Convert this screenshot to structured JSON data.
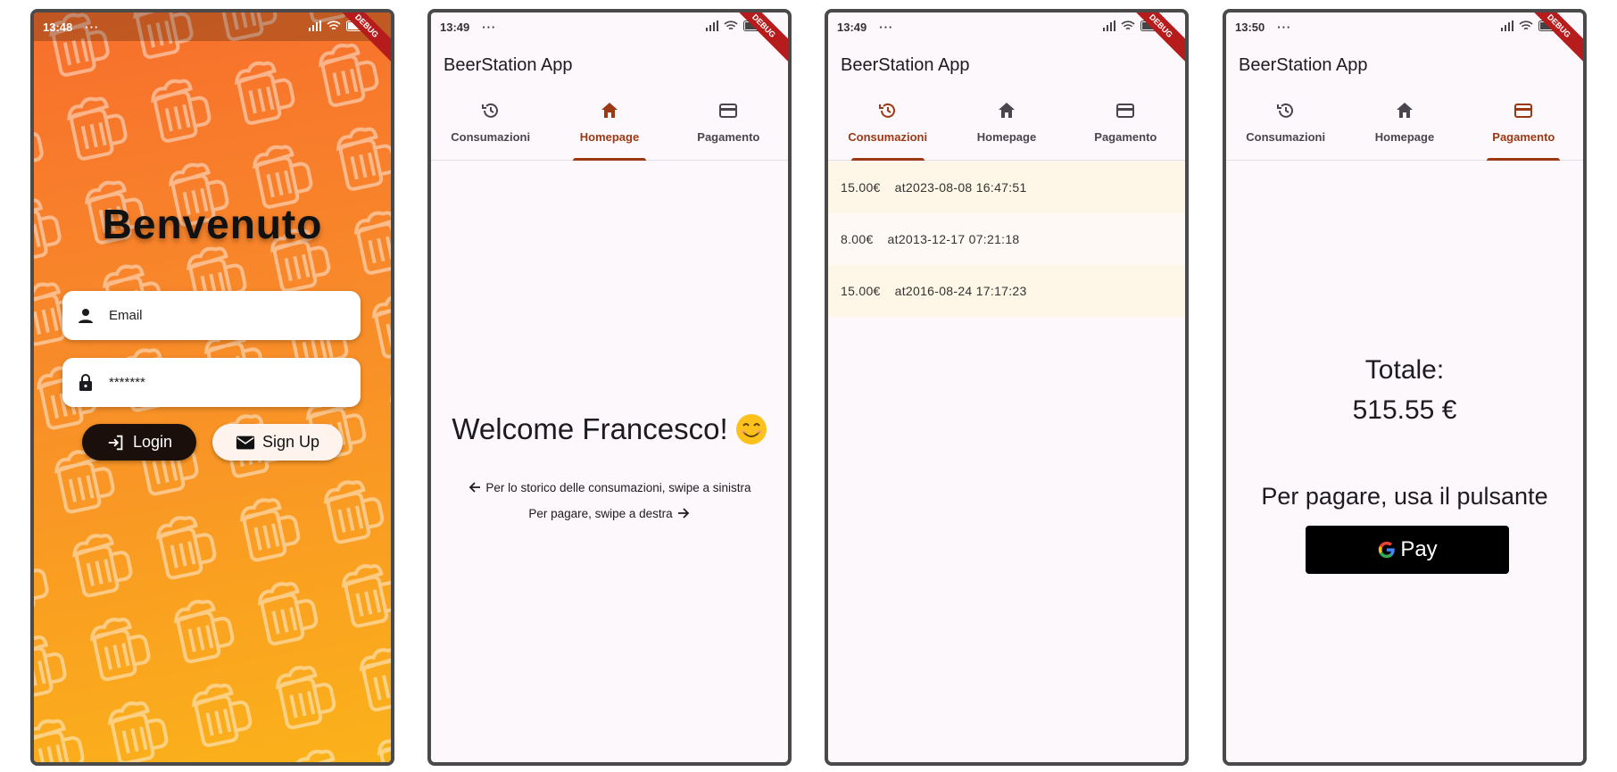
{
  "screens": {
    "login": {
      "time": "13:48",
      "status_dots": "···",
      "title": "Benvenuto",
      "email_placeholder": "Email",
      "password_value": "*******",
      "login_label": "Login",
      "signup_label": "Sign Up"
    },
    "home": {
      "time": "13:49",
      "status_dots": "···",
      "app_title": "BeerStation App",
      "welcome": "Welcome Francesco!",
      "hint_left": "Per lo storico delle consumazioni, swipe a sinistra",
      "hint_right": "Per pagare, swipe a destra"
    },
    "history": {
      "time": "13:49",
      "status_dots": "···",
      "app_title": "BeerStation App",
      "items": [
        {
          "amount": "15.00€",
          "when": "at2023-08-08 16:47:51"
        },
        {
          "amount": "8.00€",
          "when": "at2013-12-17 07:21:18"
        },
        {
          "amount": "15.00€",
          "when": "at2016-08-24 17:17:23"
        }
      ]
    },
    "payment": {
      "time": "13:50",
      "status_dots": "···",
      "app_title": "BeerStation App",
      "total_label": "Totale:",
      "total_value": "515.55 €",
      "pay_instruction": "Per pagare, usa il pulsante",
      "gpay_label": "Pay"
    }
  },
  "tabs": {
    "history_label": "Consumazioni",
    "home_label": "Homepage",
    "payment_label": "Pagamento"
  },
  "debug_banner": "DEBUG",
  "colors": {
    "accent": "#9c3812",
    "login_gradient_top": "#f76e2c",
    "login_gradient_bottom": "#fbb21a"
  },
  "icons": {
    "tab_history": "history-icon",
    "tab_home": "home-icon",
    "tab_payment": "credit-card-icon",
    "email": "person-icon",
    "password": "lock-icon",
    "login": "login-icon",
    "signup": "mail-icon"
  }
}
